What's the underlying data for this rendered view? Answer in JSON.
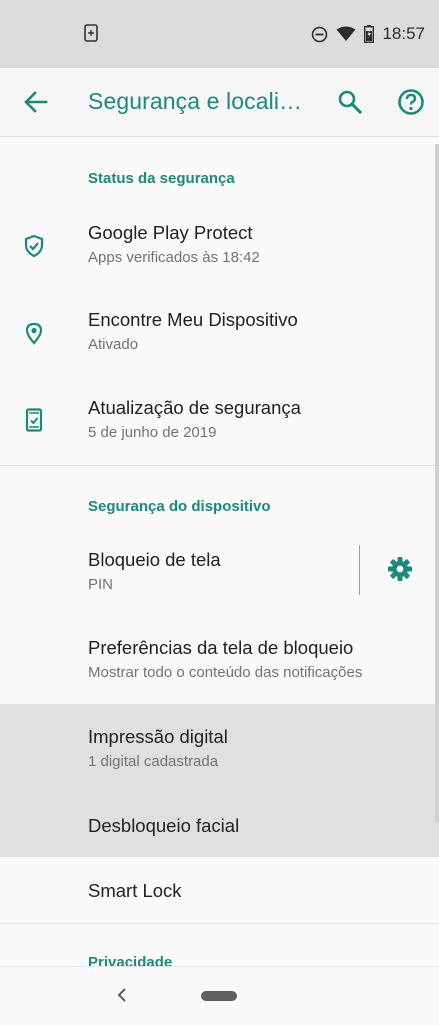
{
  "status_bar": {
    "time": "18:57",
    "icons": [
      "screenshot-icon",
      "dnd-icon",
      "wifi-icon",
      "battery-charging-icon"
    ]
  },
  "app_bar": {
    "title": "Segurança e locali…",
    "icons": [
      "back-arrow-icon",
      "search-icon",
      "help-icon"
    ]
  },
  "colors": {
    "accent": "#1a8a7a",
    "background": "#fafafa",
    "highlight": "#e0e0e0"
  },
  "sections": {
    "security_status": {
      "header": "Status da segurança",
      "items": [
        {
          "title": "Google Play Protect",
          "summary": "Apps verificados às 18:42",
          "icon": "shield-check-icon"
        },
        {
          "title": "Encontre Meu Dispositivo",
          "summary": "Ativado",
          "icon": "location-pin-icon"
        },
        {
          "title": "Atualização de segurança",
          "summary": "5 de junho de 2019",
          "icon": "phone-update-icon"
        }
      ]
    },
    "device_security": {
      "header": "Segurança do dispositivo",
      "items": [
        {
          "title": "Bloqueio de tela",
          "summary": "PIN",
          "icon": "gear-icon"
        },
        {
          "title": "Preferências da tela de bloqueio",
          "summary": "Mostrar todo o conteúdo das notificações"
        },
        {
          "title": "Impressão digital",
          "summary": "1 digital cadastrada"
        },
        {
          "title": "Desbloqueio facial"
        },
        {
          "title": "Smart Lock"
        }
      ]
    },
    "privacy": {
      "header": "Privacidade"
    }
  },
  "nav_bar": {
    "icons": [
      "nav-back-icon",
      "nav-home-pill"
    ]
  }
}
